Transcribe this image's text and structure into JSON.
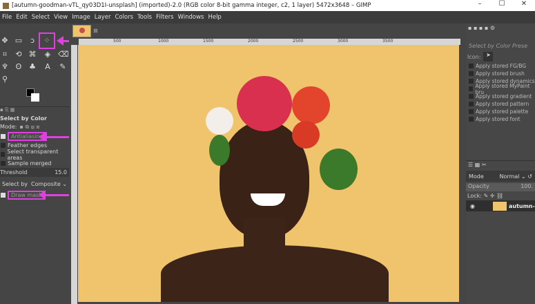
{
  "window": {
    "title": "[autumn-goodman-vTL_qy03D1I-unsplash] (imported)-2.0 (RGB color 8-bit gamma integer, c2, 1 layer) 5472x3648 – GIMP",
    "minimize": "–",
    "maximize": "☐",
    "close": "✕"
  },
  "menu": [
    "File",
    "Edit",
    "Select",
    "View",
    "Image",
    "Layer",
    "Colors",
    "Tools",
    "Filters",
    "Windows",
    "Help"
  ],
  "tool_options": {
    "title": "Select by Color",
    "mode_label": "Mode:",
    "antialiasing": "Antialiasing",
    "feather": "Feather edges",
    "transparent": "Select transparent areas",
    "sample_merged": "Sample merged",
    "threshold_label": "Threshold",
    "threshold_value": "15.0",
    "select_by_label": "Select by",
    "select_by_value": "Composite",
    "draw_mask": "Draw mask"
  },
  "ruler": [
    "500",
    "1000",
    "1500",
    "2000",
    "2500",
    "3000",
    "3500"
  ],
  "presets": {
    "title": "Select by Color Prese",
    "icon_label": "Icon:",
    "items": [
      "Apply stored FG/BG",
      "Apply stored brush",
      "Apply stored dynamics",
      "Apply stored MyPaint bru",
      "Apply stored gradient",
      "Apply stored pattern",
      "Apply stored palette",
      "Apply stored font"
    ]
  },
  "layers": {
    "mode_label": "Mode",
    "mode_value": "Normal",
    "opacity_label": "Opacity",
    "opacity_value": "100.",
    "lock_label": "Lock:",
    "layer_name": "autumn-"
  },
  "colors": {
    "highlight": "#e040e0",
    "background": "#f0c46c"
  }
}
